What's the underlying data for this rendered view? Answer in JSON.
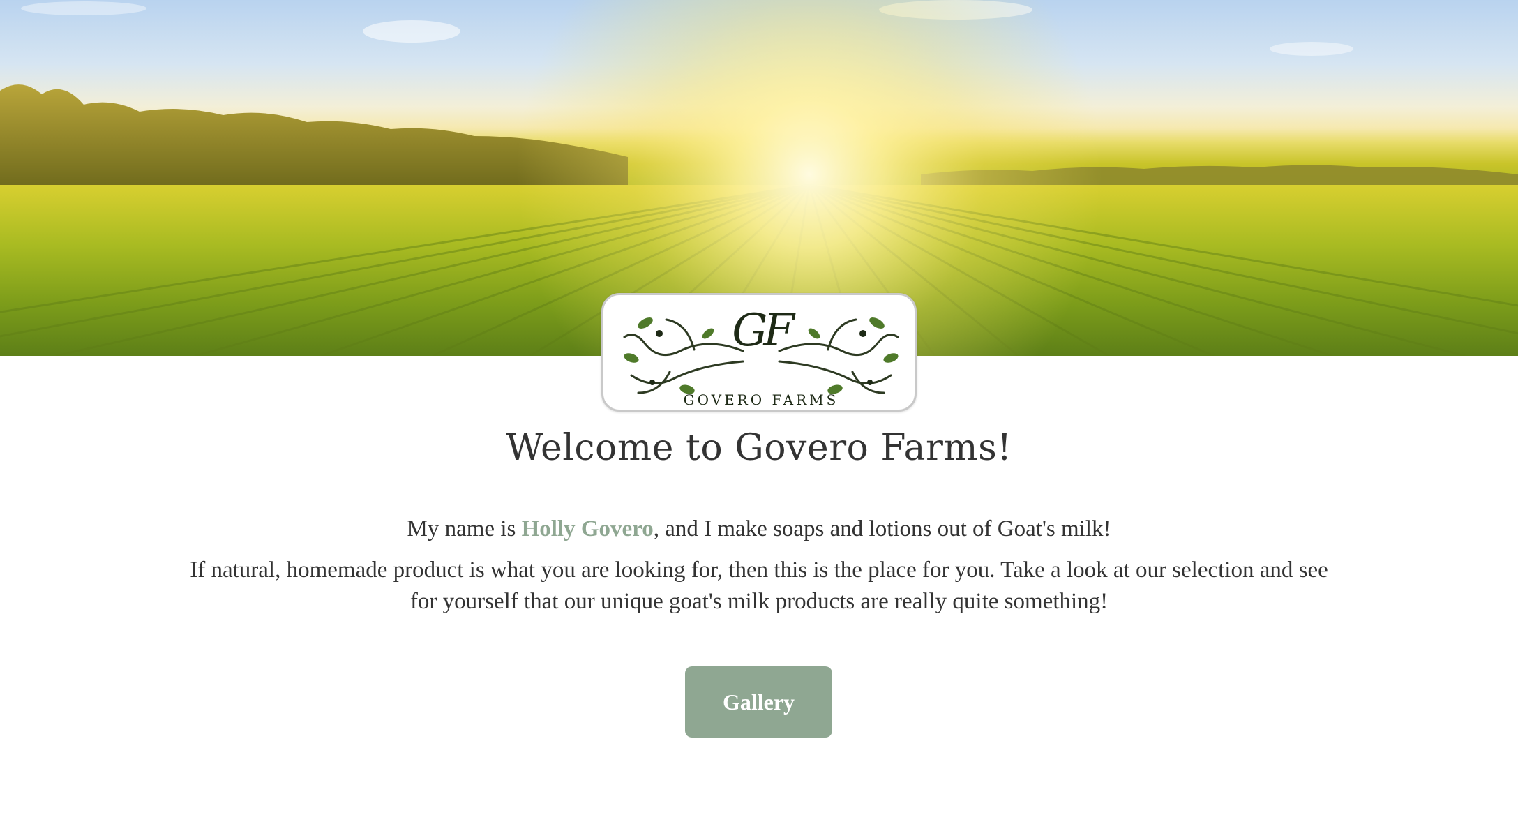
{
  "hero": {
    "image": "sunlit-cornfield-banner"
  },
  "logo": {
    "monogram": "GF",
    "wordmark": "GOVERO FARMS"
  },
  "main": {
    "title": "Welcome to Govero Farms!",
    "intro_prefix": "My name is ",
    "intro_name": "Holly Govero",
    "intro_suffix": ", and I make soaps and lotions out of Goat's milk!",
    "description": "If natural, homemade product is what you are looking for, then this is the place for you. Take a look at our selection and see for yourself that our unique goat's milk products are really quite something!",
    "gallery_label": "Gallery"
  },
  "colors": {
    "accent": "#8fa792",
    "text": "#333333",
    "background": "#ffffff"
  }
}
